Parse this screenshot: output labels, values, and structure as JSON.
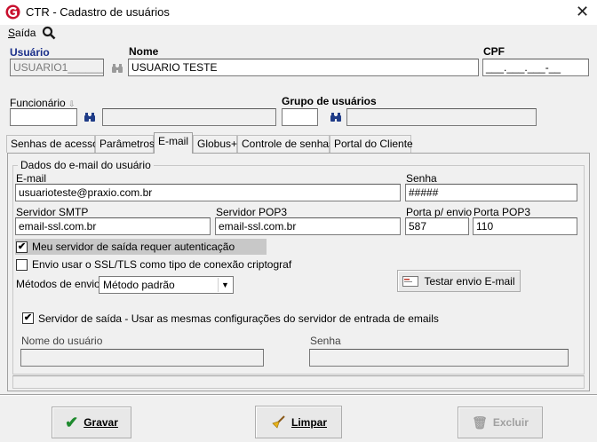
{
  "window": {
    "title": "CTR - Cadastro de usuários"
  },
  "menu": {
    "saida_prefix": "S",
    "saida_rest": "aída"
  },
  "header": {
    "usuario_label": "Usuário",
    "usuario_value": "USUARIO1______",
    "nome_label": "Nome",
    "nome_value": "USUARIO TESTE",
    "cpf_label": "CPF",
    "cpf_value": "___.___.___-__",
    "funcionario_label": "Funcionário",
    "funcionario_value": "",
    "funcionario_desc": "",
    "grupo_label": "Grupo de usuários",
    "grupo_value": "",
    "grupo_desc": ""
  },
  "tabs": [
    {
      "label": "Senhas de acesso"
    },
    {
      "label": "Parâmetros"
    },
    {
      "label": "E-mail"
    },
    {
      "label": "Globus+"
    },
    {
      "label": "Controle de senhas"
    },
    {
      "label": "Portal do Cliente"
    }
  ],
  "email": {
    "group_title": "Dados do e-mail do usuário",
    "email_label": "E-mail",
    "email_value": "usuarioteste@praxio.com.br",
    "senha_label": "Senha",
    "senha_value": "#####",
    "smtp_label": "Servidor SMTP",
    "smtp_value": "email-ssl.com.br",
    "pop3_label": "Servidor POP3",
    "pop3_value": "email-ssl.com.br",
    "porta_envio_label": "Porta p/ envio",
    "porta_envio_value": "587",
    "porta_pop3_label": "Porta POP3",
    "porta_pop3_value": "110",
    "auth_label": "Meu servidor de saída requer autenticação",
    "auth_checked": true,
    "ssl_label": "Envio usar o SSL/TLS como tipo de conexão criptograf",
    "ssl_checked": false,
    "metodos_label": "Métodos de envio",
    "metodos_value": "Método padrão",
    "testar_label": "Testar envio E-mail",
    "same_config_label": "Servidor de saída - Usar as mesmas configurações do servidor de entrada de emails",
    "same_config_checked": true,
    "nome_usuario_label": "Nome do usuário",
    "nome_usuario_value": "",
    "senha2_label": "Senha",
    "senha2_value": ""
  },
  "footer": {
    "gravar_label": "Gravar",
    "limpar_label": "Limpar",
    "excluir_label": "Excluir"
  }
}
